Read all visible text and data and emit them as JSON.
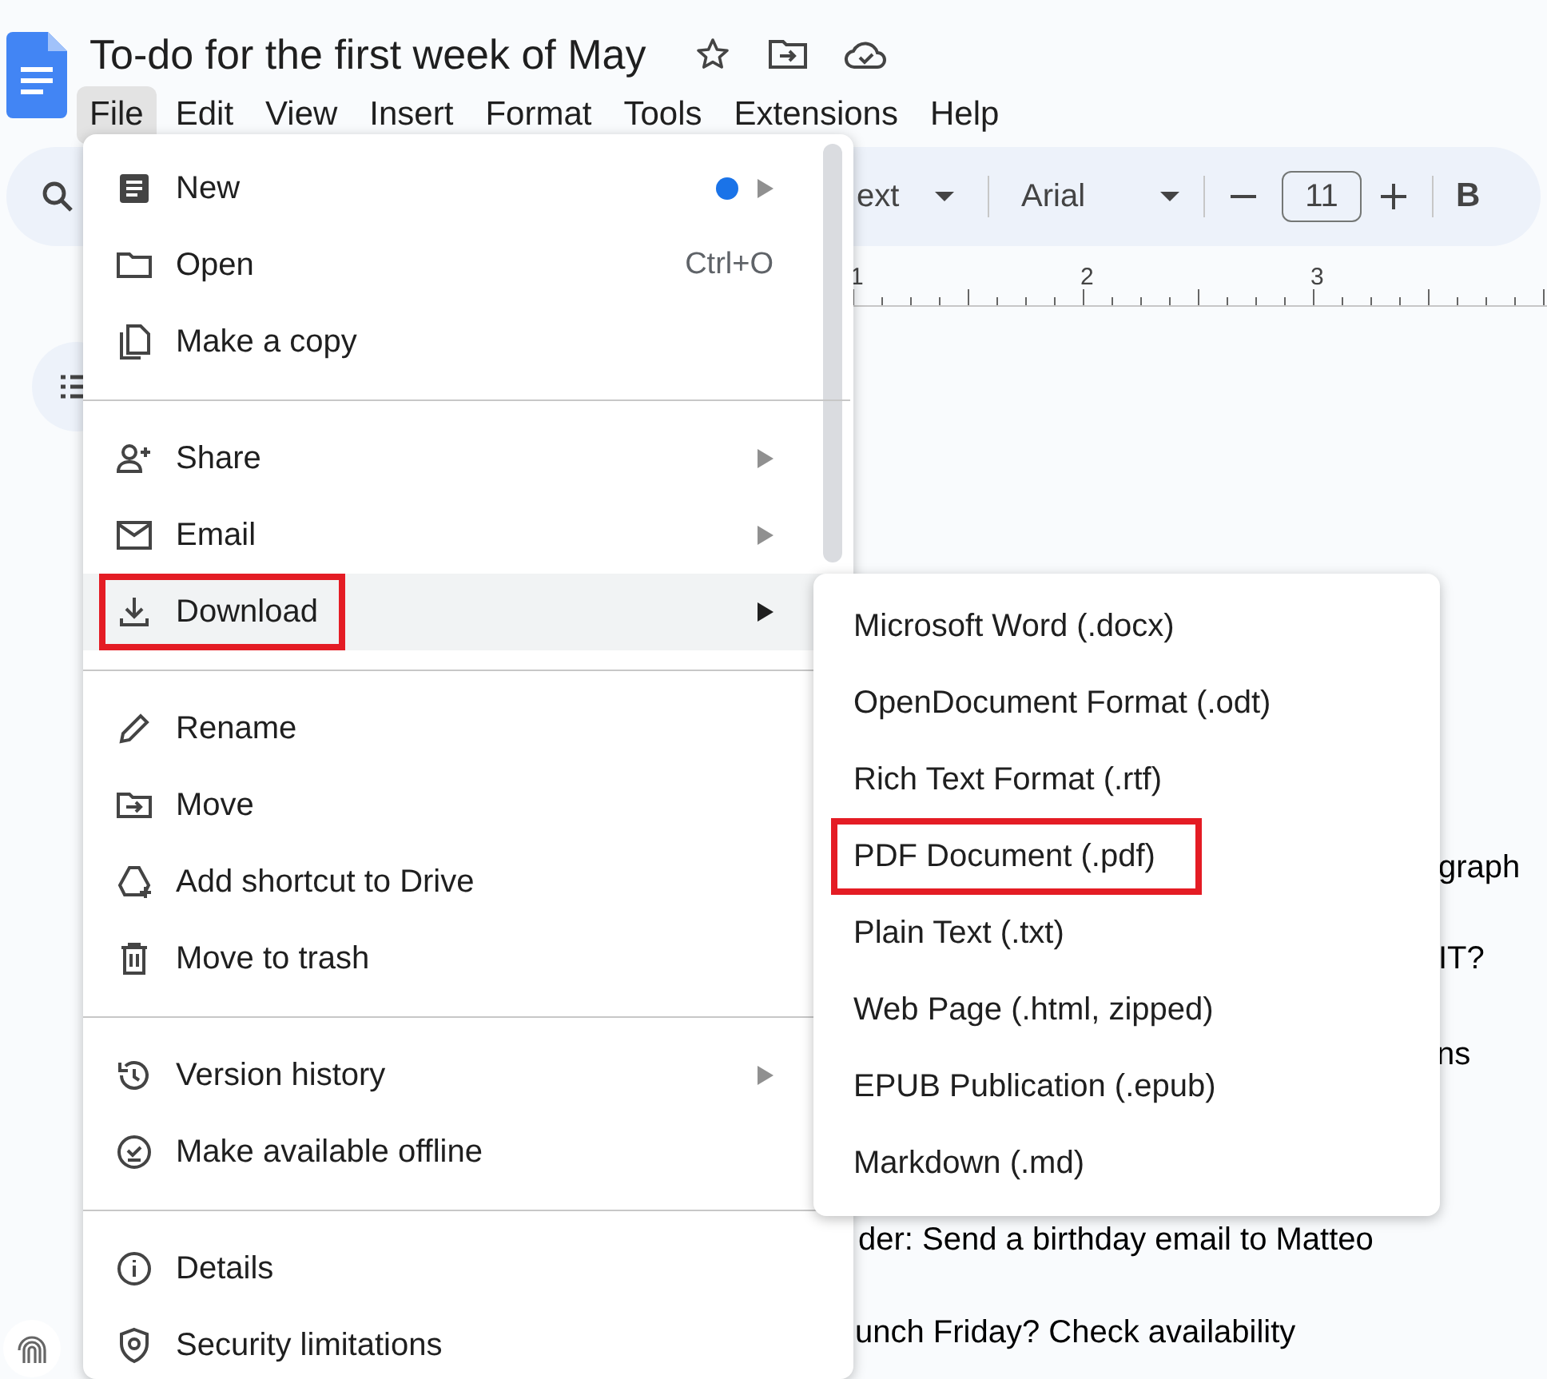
{
  "document": {
    "title": "To-do for the first week of May"
  },
  "menubar": [
    {
      "label": "File",
      "selected": true
    },
    {
      "label": "Edit",
      "selected": false
    },
    {
      "label": "View",
      "selected": false
    },
    {
      "label": "Insert",
      "selected": false
    },
    {
      "label": "Format",
      "selected": false
    },
    {
      "label": "Tools",
      "selected": false
    },
    {
      "label": "Extensions",
      "selected": false
    },
    {
      "label": "Help",
      "selected": false
    }
  ],
  "toolbar": {
    "style_dropdown": "ext",
    "font_dropdown": "Arial",
    "font_size": "11",
    "bold": "B"
  },
  "ruler": [
    "1",
    "2",
    "3"
  ],
  "document_lines": [
    "graph",
    "IT?",
    "ns",
    "der: Send a birthday email to Matteo",
    "unch Friday? Check availability"
  ],
  "file_menu": {
    "groups": [
      [
        {
          "label": "New",
          "submenu": true,
          "dot": true,
          "selected": false,
          "annotated": false
        },
        {
          "label": "Open",
          "shortcut": "Ctrl+O",
          "submenu": false,
          "dot": false,
          "selected": false,
          "annotated": false
        },
        {
          "label": "Make a copy",
          "submenu": false,
          "dot": false,
          "selected": false,
          "annotated": false
        }
      ],
      [
        {
          "label": "Share",
          "submenu": true,
          "dot": false,
          "selected": false,
          "annotated": false
        },
        {
          "label": "Email",
          "submenu": true,
          "dot": false,
          "selected": false,
          "annotated": false
        },
        {
          "label": "Download",
          "submenu": true,
          "dot": false,
          "selected": true,
          "annotated": true
        }
      ],
      [
        {
          "label": "Rename",
          "submenu": false,
          "dot": false,
          "selected": false,
          "annotated": false
        },
        {
          "label": "Move",
          "submenu": false,
          "dot": false,
          "selected": false,
          "annotated": false
        },
        {
          "label": "Add shortcut to Drive",
          "submenu": false,
          "dot": false,
          "selected": false,
          "annotated": false
        },
        {
          "label": "Move to trash",
          "submenu": false,
          "dot": false,
          "selected": false,
          "annotated": false
        }
      ],
      [
        {
          "label": "Version history",
          "submenu": true,
          "dot": false,
          "selected": false,
          "annotated": false
        },
        {
          "label": "Make available offline",
          "submenu": false,
          "dot": false,
          "selected": false,
          "annotated": false
        }
      ],
      [
        {
          "label": "Details",
          "submenu": false,
          "dot": false,
          "selected": false,
          "annotated": false
        },
        {
          "label": "Security limitations",
          "submenu": false,
          "dot": false,
          "selected": false,
          "annotated": false
        }
      ]
    ]
  },
  "download_submenu": [
    {
      "label": "Microsoft Word (.docx)",
      "annotated": false
    },
    {
      "label": "OpenDocument Format (.odt)",
      "annotated": false
    },
    {
      "label": "Rich Text Format (.rtf)",
      "annotated": false
    },
    {
      "label": "PDF Document (.pdf)",
      "annotated": true
    },
    {
      "label": "Plain Text (.txt)",
      "annotated": false
    },
    {
      "label": "Web Page (.html, zipped)",
      "annotated": false
    },
    {
      "label": "EPUB Publication (.epub)",
      "annotated": false
    },
    {
      "label": "Markdown (.md)",
      "annotated": false
    }
  ]
}
